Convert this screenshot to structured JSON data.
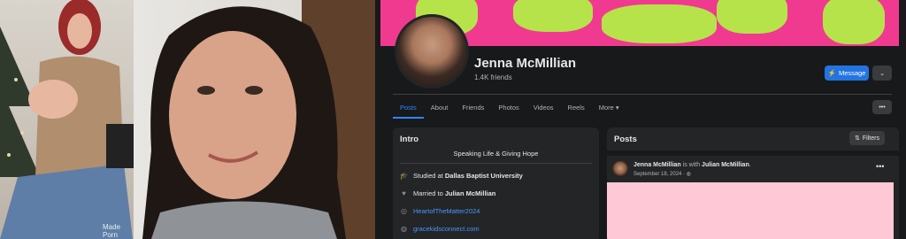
{
  "left_photos": {
    "watermark": "Made Porn"
  },
  "facebook": {
    "profile": {
      "name": "Jenna McMillian",
      "friends": "1.4K friends"
    },
    "actions": {
      "message_label": "Message",
      "more_caret": "⌄"
    },
    "tabs": [
      {
        "label": "Posts",
        "active": true
      },
      {
        "label": "About"
      },
      {
        "label": "Friends"
      },
      {
        "label": "Photos"
      },
      {
        "label": "Videos"
      },
      {
        "label": "Reels"
      },
      {
        "label": "More ▾"
      }
    ],
    "tabs_more_label": "•••",
    "intro": {
      "title": "Intro",
      "bio": "Speaking Life & Giving Hope",
      "studied_prefix": "Studied at",
      "studied_school": "Dallas Baptist University",
      "married_prefix": "Married to",
      "married_name": "Julian McMillian",
      "instagram": "HeartofTheMatter2024",
      "website": "gracekidsconnect.com"
    },
    "posts": {
      "title": "Posts",
      "filters_label": "Filters",
      "post": {
        "author": "Jenna McMillian",
        "with_text": "is with",
        "with_name": "Julian McMillian",
        "date": "September 18, 2024 · ",
        "menu": "•••"
      }
    },
    "colors": {
      "background": "#18191a",
      "card": "#242526",
      "accent_blue": "#2374e1",
      "cover_pink": "#f03a8f",
      "cover_green": "#b7e34a",
      "post_media_pink": "#ffc8d6"
    }
  }
}
